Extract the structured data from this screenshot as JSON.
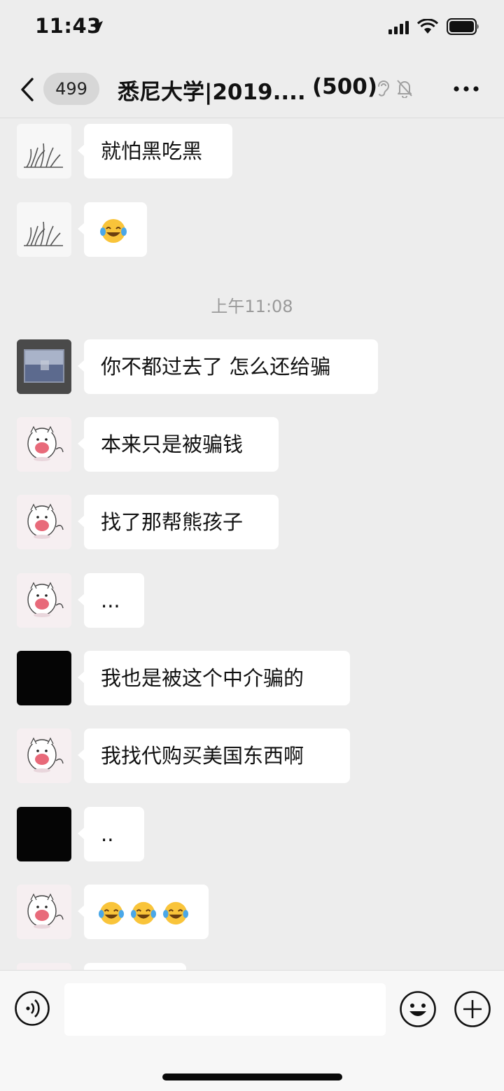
{
  "status_bar": {
    "time": "11:43"
  },
  "nav": {
    "unread_count": "499",
    "title": "悉尼大学|2019....",
    "member_count": "(500)"
  },
  "timestamp": "上午11:08",
  "messages": [
    {
      "avatar": "grass-avatar",
      "text": "就怕黑吃黑"
    },
    {
      "avatar": "grass-avatar",
      "emoji": [
        "tears-of-joy-emoji"
      ]
    },
    {
      "avatar": "photo-avatar",
      "text": "你不都过去了 怎么还给骗"
    },
    {
      "avatar": "pig-avatar",
      "text": "本来只是被骗钱"
    },
    {
      "avatar": "pig-avatar",
      "text": "找了那帮熊孩子"
    },
    {
      "avatar": "pig-avatar",
      "text": "..."
    },
    {
      "avatar": "black-avatar",
      "text": "我也是被这个中介骗的"
    },
    {
      "avatar": "pig-avatar",
      "text": "我找代购买美国东西啊"
    },
    {
      "avatar": "black-avatar",
      "text": ".."
    },
    {
      "avatar": "pig-avatar",
      "emoji": [
        "tears-of-joy-emoji",
        "tears-of-joy-emoji",
        "tears-of-joy-emoji"
      ]
    }
  ],
  "input": {
    "placeholder": ""
  }
}
